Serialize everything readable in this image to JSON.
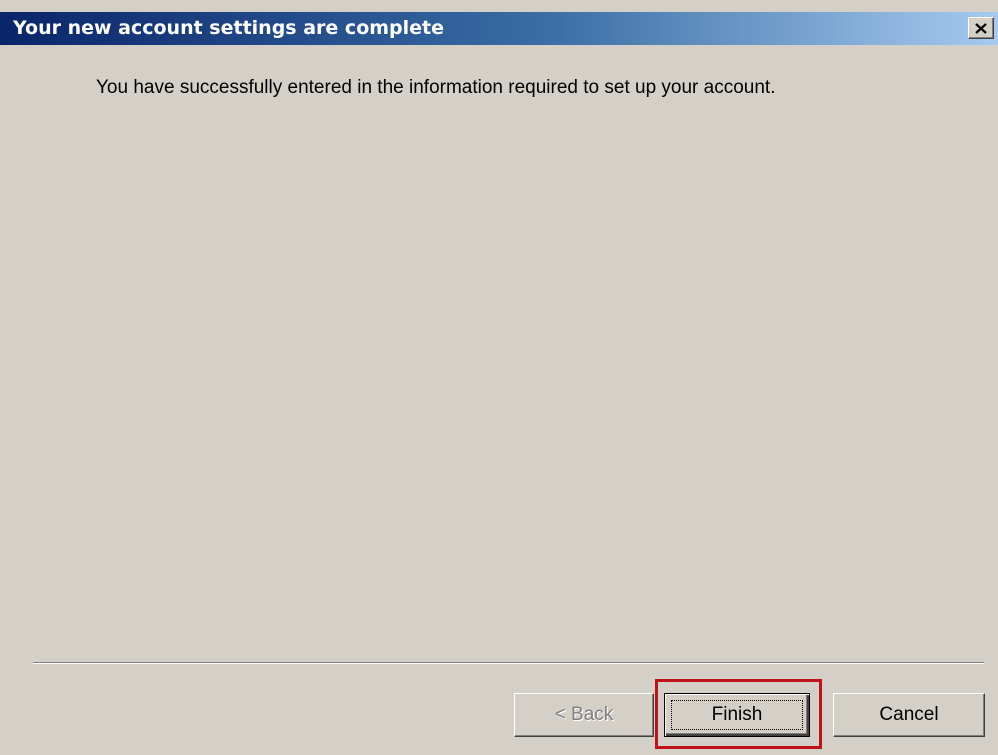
{
  "window": {
    "title": "Your new account settings are complete"
  },
  "content": {
    "message": "You have successfully entered in the information required to set up your account."
  },
  "buttons": {
    "back_label": "< Back",
    "back_enabled": false,
    "finish_label": "Finish",
    "cancel_label": "Cancel"
  },
  "icons": {
    "close": "close-icon"
  },
  "colors": {
    "title_gradient_start": "#0a246a",
    "title_gradient_end": "#a6caf0",
    "dialog_background": "#d4d0c8",
    "highlight_border": "#c0101a"
  }
}
